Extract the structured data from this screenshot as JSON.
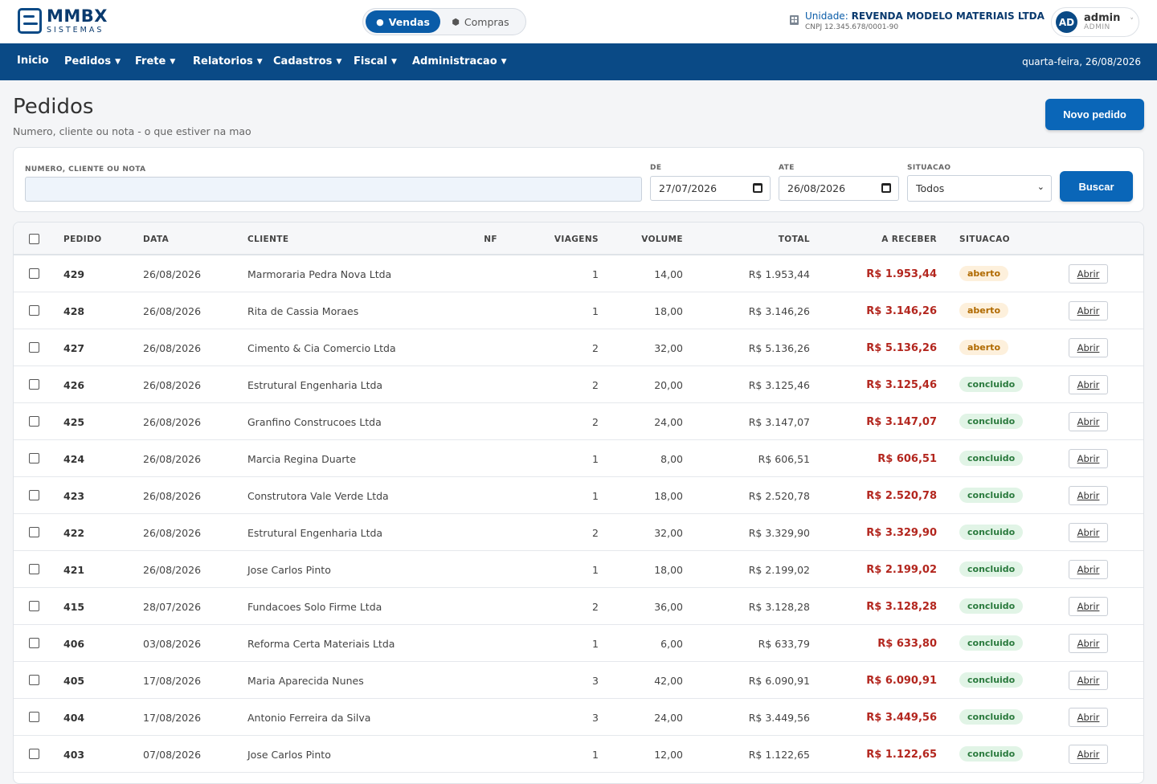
{
  "brand": {
    "name": "MMBX",
    "sub": "SISTEMAS"
  },
  "mode_switch": {
    "vendas": "Vendas",
    "compras": "Compras"
  },
  "unit": {
    "prefix": "Unidade:",
    "name": "REVENDA MODELO MATERIAIS LTDA",
    "cnpj": "CNPJ 12.345.678/0001-90"
  },
  "user": {
    "initials": "AD",
    "name": "admin",
    "role": "ADMIN"
  },
  "nav": {
    "items": [
      "Inicio",
      "Pedidos",
      "Frete",
      "Relatorios",
      "Cadastros",
      "Fiscal",
      "Administracao"
    ],
    "date": "quarta-feira, 26/08/2026"
  },
  "page": {
    "title": "Pedidos",
    "subtitle": "Numero, cliente ou nota - o que estiver na mao",
    "new_button": "Novo pedido"
  },
  "filters": {
    "search_label": "NUMERO, CLIENTE OU NOTA",
    "search_value": "",
    "from_label": "DE",
    "from_value": "27/07/2026",
    "to_label": "ATE",
    "to_value": "26/08/2026",
    "status_label": "SITUACAO",
    "status_value": "Todos",
    "search_button": "Buscar"
  },
  "table": {
    "headers": [
      "PEDIDO",
      "DATA",
      "CLIENTE",
      "NF",
      "VIAGENS",
      "VOLUME",
      "TOTAL",
      "A RECEBER",
      "SITUACAO"
    ],
    "open_label": "Abrir",
    "rows": [
      {
        "pedido": "429",
        "data": "26/08/2026",
        "cliente": "Marmoraria Pedra Nova Ltda",
        "nf": "",
        "viagens": "1",
        "volume": "14,00",
        "total": "R$ 1.953,44",
        "receber": "R$ 1.953,44",
        "situacao": "aberto"
      },
      {
        "pedido": "428",
        "data": "26/08/2026",
        "cliente": "Rita de Cassia Moraes",
        "nf": "",
        "viagens": "1",
        "volume": "18,00",
        "total": "R$ 3.146,26",
        "receber": "R$ 3.146,26",
        "situacao": "aberto"
      },
      {
        "pedido": "427",
        "data": "26/08/2026",
        "cliente": "Cimento & Cia Comercio Ltda",
        "nf": "",
        "viagens": "2",
        "volume": "32,00",
        "total": "R$ 5.136,26",
        "receber": "R$ 5.136,26",
        "situacao": "aberto"
      },
      {
        "pedido": "426",
        "data": "26/08/2026",
        "cliente": "Estrutural Engenharia Ltda",
        "nf": "",
        "viagens": "2",
        "volume": "20,00",
        "total": "R$ 3.125,46",
        "receber": "R$ 3.125,46",
        "situacao": "concluido"
      },
      {
        "pedido": "425",
        "data": "26/08/2026",
        "cliente": "Granfino Construcoes Ltda",
        "nf": "",
        "viagens": "2",
        "volume": "24,00",
        "total": "R$ 3.147,07",
        "receber": "R$ 3.147,07",
        "situacao": "concluido"
      },
      {
        "pedido": "424",
        "data": "26/08/2026",
        "cliente": "Marcia Regina Duarte",
        "nf": "",
        "viagens": "1",
        "volume": "8,00",
        "total": "R$ 606,51",
        "receber": "R$ 606,51",
        "situacao": "concluido"
      },
      {
        "pedido": "423",
        "data": "26/08/2026",
        "cliente": "Construtora Vale Verde Ltda",
        "nf": "",
        "viagens": "1",
        "volume": "18,00",
        "total": "R$ 2.520,78",
        "receber": "R$ 2.520,78",
        "situacao": "concluido"
      },
      {
        "pedido": "422",
        "data": "26/08/2026",
        "cliente": "Estrutural Engenharia Ltda",
        "nf": "",
        "viagens": "2",
        "volume": "32,00",
        "total": "R$ 3.329,90",
        "receber": "R$ 3.329,90",
        "situacao": "concluido"
      },
      {
        "pedido": "421",
        "data": "26/08/2026",
        "cliente": "Jose Carlos Pinto",
        "nf": "",
        "viagens": "1",
        "volume": "18,00",
        "total": "R$ 2.199,02",
        "receber": "R$ 2.199,02",
        "situacao": "concluido"
      },
      {
        "pedido": "415",
        "data": "28/07/2026",
        "cliente": "Fundacoes Solo Firme Ltda",
        "nf": "",
        "viagens": "2",
        "volume": "36,00",
        "total": "R$ 3.128,28",
        "receber": "R$ 3.128,28",
        "situacao": "concluido"
      },
      {
        "pedido": "406",
        "data": "03/08/2026",
        "cliente": "Reforma Certa Materiais Ltda",
        "nf": "",
        "viagens": "1",
        "volume": "6,00",
        "total": "R$ 633,79",
        "receber": "R$ 633,80",
        "situacao": "concluido"
      },
      {
        "pedido": "405",
        "data": "17/08/2026",
        "cliente": "Maria Aparecida Nunes",
        "nf": "",
        "viagens": "3",
        "volume": "42,00",
        "total": "R$ 6.090,91",
        "receber": "R$ 6.090,91",
        "situacao": "concluido"
      },
      {
        "pedido": "404",
        "data": "17/08/2026",
        "cliente": "Antonio Ferreira da Silva",
        "nf": "",
        "viagens": "3",
        "volume": "24,00",
        "total": "R$ 3.449,56",
        "receber": "R$ 3.449,56",
        "situacao": "concluido"
      },
      {
        "pedido": "403",
        "data": "07/08/2026",
        "cliente": "Jose Carlos Pinto",
        "nf": "",
        "viagens": "1",
        "volume": "12,00",
        "total": "R$ 1.122,65",
        "receber": "R$ 1.122,65",
        "situacao": "concluido"
      }
    ]
  }
}
